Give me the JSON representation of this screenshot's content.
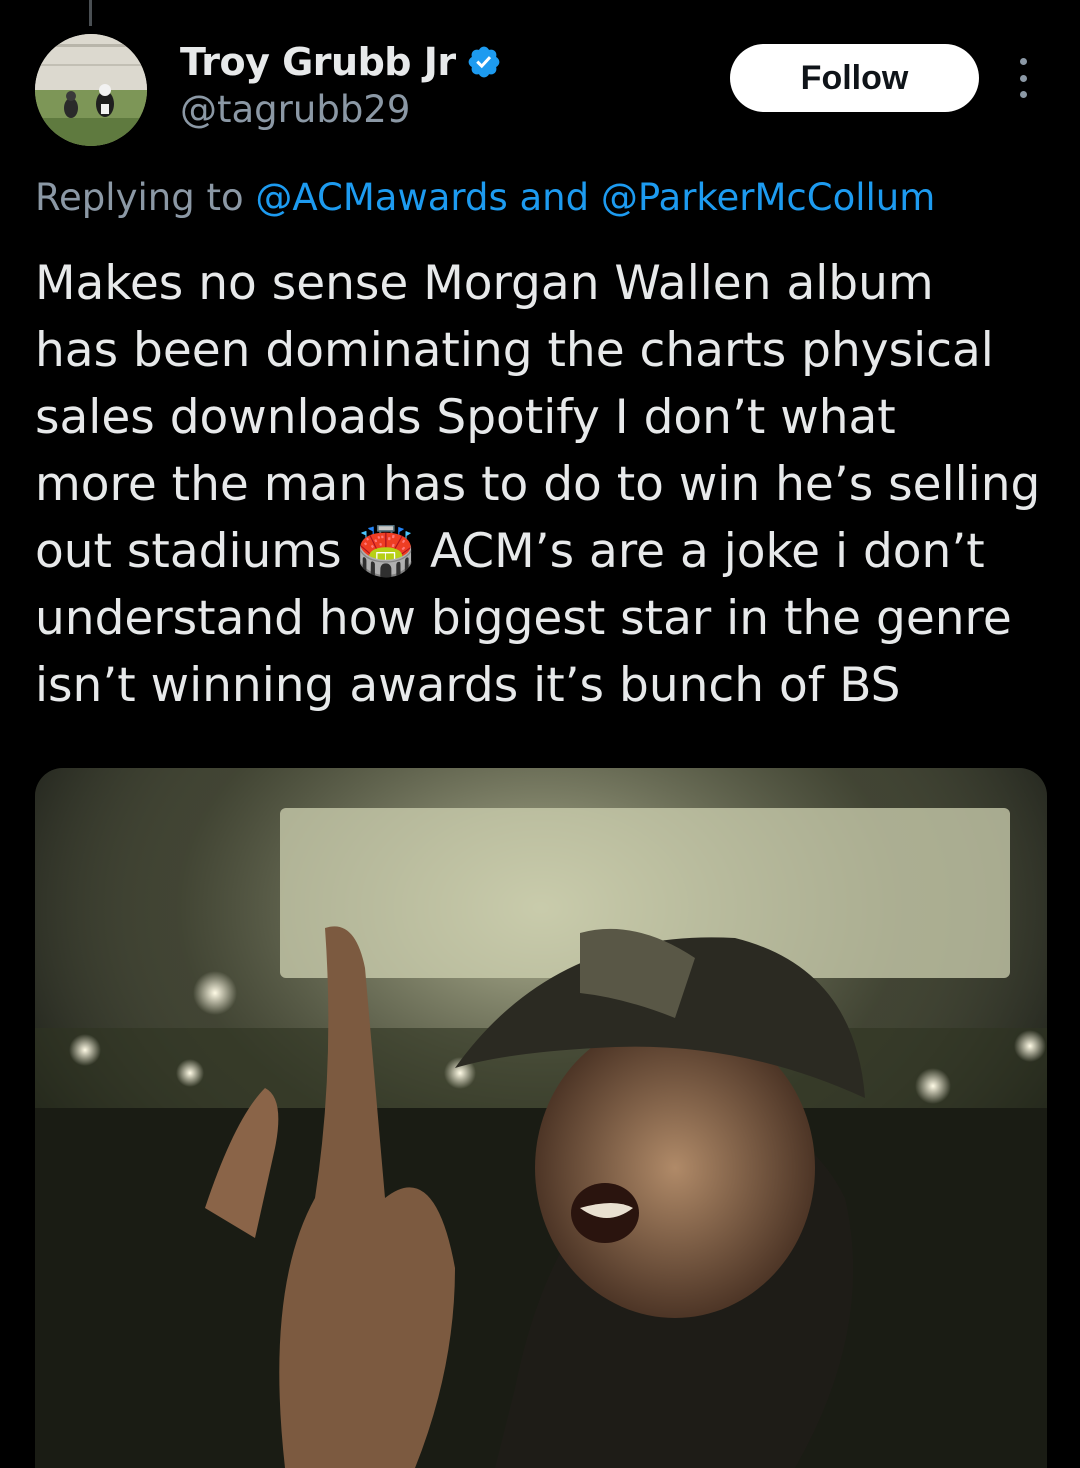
{
  "tweet": {
    "author": {
      "display_name": "Troy Grubb Jr",
      "handle": "@tagrubb29",
      "verified": true,
      "avatar_icon": "avatar-dogs-on-lawn"
    },
    "follow_label": "Follow",
    "more_icon": "more-vertical-icon",
    "replying_prefix": "Replying to",
    "reply_mention_1": "@ACMawards",
    "reply_conjunction": "and",
    "reply_mention_2": "@ParkerMcCollum",
    "text": "Makes no sense Morgan Wallen album\nhas been dominating the charts physical\nsales downloads Spotify I don’t what\nmore the man has to do to win he’s selling\nout stadiums 🏟️ ACM’s are a joke i don’t\nunderstand how biggest star in the genre\nisn’t winning awards it’s bunch of BS",
    "media": {
      "type": "image",
      "icon": "media-image-icon"
    }
  },
  "colors": {
    "background": "#000000",
    "text_primary": "#e7e9ea",
    "text_secondary": "#8b98a5",
    "link": "#1d9bf0",
    "follow_bg": "#ffffff",
    "verified_badge": "#1d9bf0"
  }
}
